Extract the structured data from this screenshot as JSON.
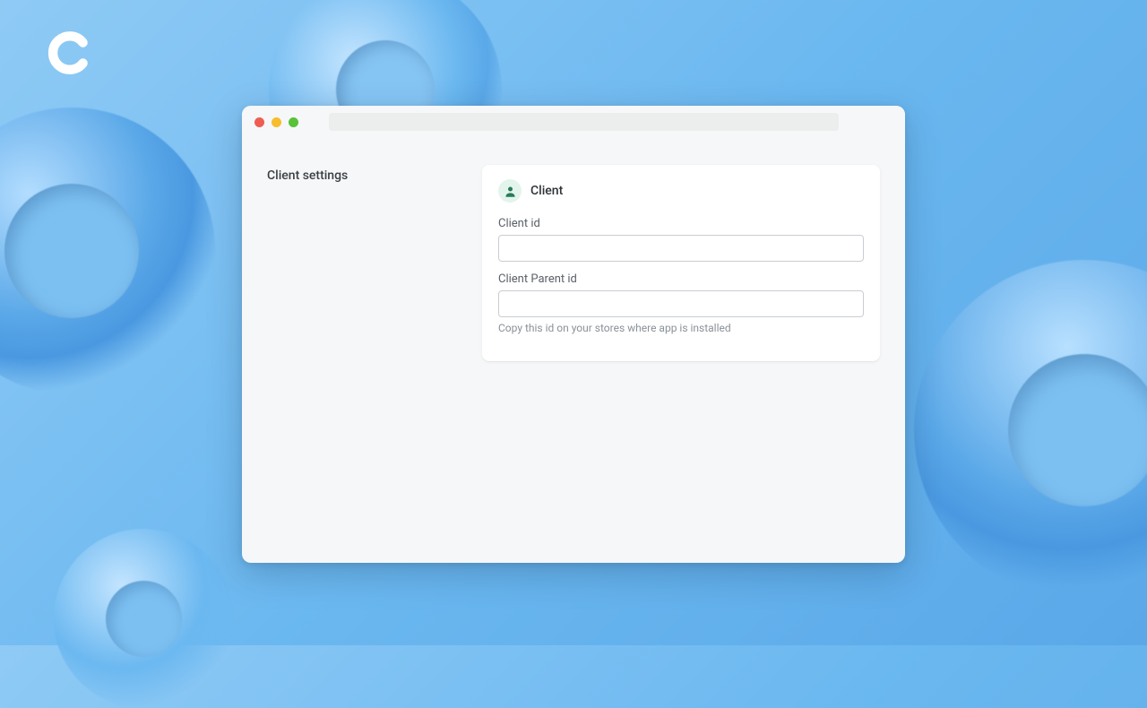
{
  "logo": {
    "letter": "C"
  },
  "sidebar": {
    "title": "Client settings"
  },
  "card": {
    "title": "Client",
    "fields": {
      "client_id": {
        "label": "Client id",
        "value": ""
      },
      "client_parent_id": {
        "label": "Client Parent id",
        "value": "",
        "helper": "Copy this id on your stores where app is installed"
      }
    }
  }
}
